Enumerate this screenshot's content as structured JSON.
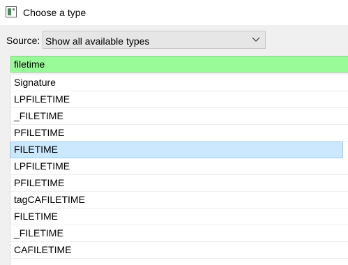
{
  "window": {
    "title": "Choose a type",
    "icon": "type-chooser-icon"
  },
  "source": {
    "label": "Source:",
    "selected": "Show all available types",
    "chevron_icon": "chevron-down-icon"
  },
  "filter": {
    "value": "filetime",
    "background_color": "#98fb98"
  },
  "list": {
    "selected_index": 4,
    "selection_color": "#cce8ff",
    "items": [
      "Signature",
      "LPFILETIME",
      "_FILETIME",
      "PFILETIME",
      "FILETIME",
      "LPFILETIME",
      "PFILETIME",
      "tagCAFILETIME",
      "FILETIME",
      "_FILETIME",
      "CAFILETIME"
    ]
  }
}
